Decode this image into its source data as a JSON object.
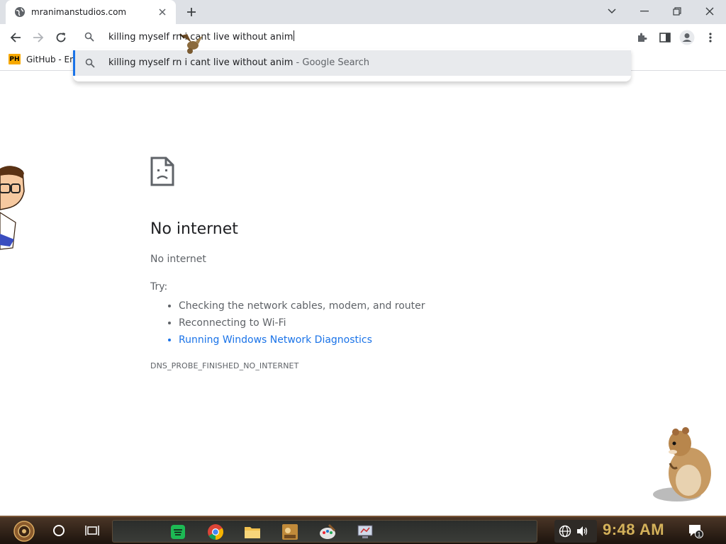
{
  "browser": {
    "tab": {
      "title": "mranimanstudios.com"
    },
    "omnibox": {
      "text": "killing myself rn i cant live without anim"
    },
    "suggestion": {
      "query": "killing myself rn i cant live without anim",
      "provider": "- Google Search"
    },
    "bookmarks": [
      {
        "icon_text": "PH",
        "label": "GitHub - En"
      }
    ]
  },
  "error_page": {
    "title": "No internet",
    "subtitle": "No internet",
    "try_label": "Try:",
    "suggestions": [
      "Checking the network cables, modem, and router",
      "Reconnecting to Wi-Fi",
      "Running Windows Network Diagnostics"
    ],
    "error_code": "DNS_PROBE_FINISHED_NO_INTERNET"
  },
  "taskbar": {
    "clock": "9:48 AM",
    "notification_count": "1",
    "apps": [
      "spotify-icon",
      "chrome-icon",
      "file-explorer-icon",
      "game-box-icon",
      "paint-icon",
      "remote-desktop-icon"
    ]
  },
  "colors": {
    "link": "#1a73e8",
    "tabstrip": "#dee1e6",
    "clock": "#d4b15a"
  }
}
